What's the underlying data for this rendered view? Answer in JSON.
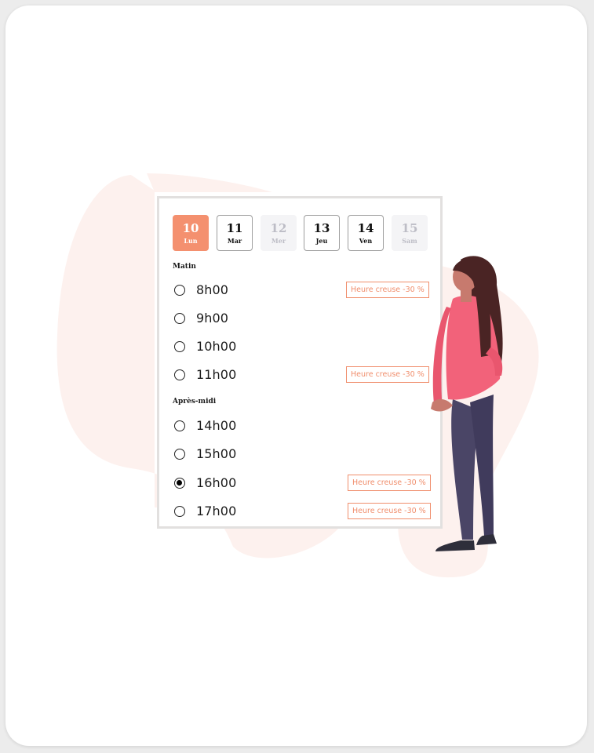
{
  "colors": {
    "accent": "#f4906f",
    "badge": "#f08e6c",
    "blob": "#fdf1ee",
    "disabled_bg": "#f4f4f6"
  },
  "days": [
    {
      "num": "10",
      "name": "Lun",
      "state": "selected"
    },
    {
      "num": "11",
      "name": "Mar",
      "state": "available"
    },
    {
      "num": "12",
      "name": "Mer",
      "state": "disabled"
    },
    {
      "num": "13",
      "name": "Jeu",
      "state": "available"
    },
    {
      "num": "14",
      "name": "Ven",
      "state": "available"
    },
    {
      "num": "15",
      "name": "Sam",
      "state": "disabled"
    }
  ],
  "morning": {
    "title": "Matin",
    "slots": [
      {
        "time": "8h00",
        "badge": "Heure creuse -30 %",
        "selected": false
      },
      {
        "time": "9h00",
        "badge": "",
        "selected": false
      },
      {
        "time": "10h00",
        "badge": "",
        "selected": false
      },
      {
        "time": "11h00",
        "badge": "Heure creuse -30 %",
        "selected": false
      }
    ]
  },
  "afternoon": {
    "title": "Après-midi",
    "slots": [
      {
        "time": "14h00",
        "badge": "",
        "selected": false
      },
      {
        "time": "15h00",
        "badge": "",
        "selected": false
      },
      {
        "time": "16h00",
        "badge": "Heure creuse -30 %",
        "selected": true
      },
      {
        "time": "17h00",
        "badge": "Heure creuse -30 %",
        "selected": false
      }
    ]
  },
  "illustration": {
    "icon": "woman-standing-illustration"
  }
}
